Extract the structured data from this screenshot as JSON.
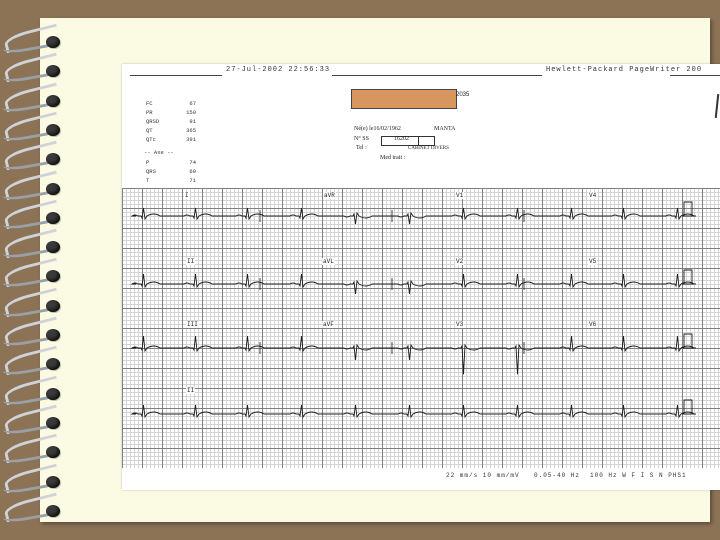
{
  "ecg": {
    "header": {
      "datetime": "27-Jul-2002   22:56:33",
      "device": "Hewlett-Packard PageWriter 200"
    },
    "measurements": [
      {
        "label": "FC",
        "value": "67"
      },
      {
        "label": "PR",
        "value": "150"
      },
      {
        "label": "QRSD",
        "value": "91"
      },
      {
        "label": "QT",
        "value": "365"
      },
      {
        "label": "QTc",
        "value": "391"
      }
    ],
    "axes_title": "-- Axe --",
    "axes": [
      {
        "label": "P",
        "value": "74"
      },
      {
        "label": "QRS",
        "value": "69"
      },
      {
        "label": "T",
        "value": "71"
      }
    ],
    "patient": {
      "id_suffix": "2035",
      "born": "Né(e) le16/02/1962",
      "sex": "MANTA",
      "ss_label": "N° SS",
      "ss_value": "16202",
      "tel_label": "Tel :",
      "service": "CABINET DIVERS",
      "med_label": "Med trait :"
    },
    "leads": [
      "I",
      "aVR",
      "V1",
      "V4",
      "II",
      "aVL",
      "V2",
      "V5",
      "III",
      "aVF",
      "V3",
      "V6",
      "II"
    ],
    "footer": {
      "left": "22 mm/s   10 mm/mV",
      "mid": "0.05-40 Hz",
      "right": "100 Hz W   F I S N   PHS1"
    }
  }
}
